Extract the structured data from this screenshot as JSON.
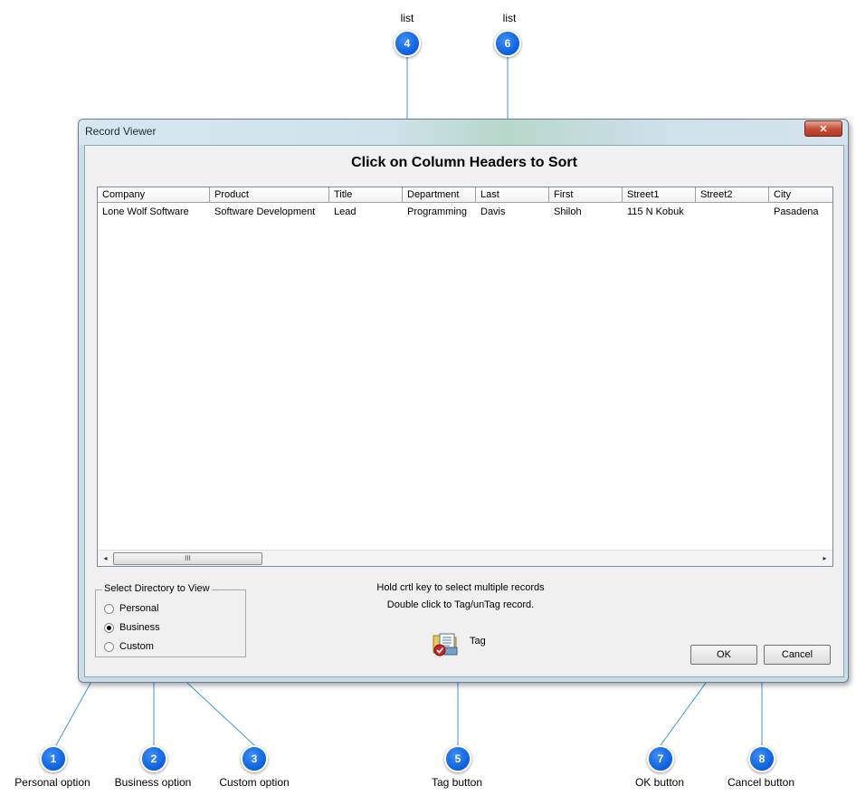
{
  "window": {
    "title": "Record Viewer",
    "close_glyph": "✕",
    "heading": "Click on Column Headers to Sort"
  },
  "list": {
    "columns": [
      "Company",
      "Product",
      "Title",
      "Department",
      "Last",
      "First",
      "Street1",
      "Street2",
      "City"
    ],
    "rows": [
      [
        "Lone Wolf Software",
        "Software Development",
        "Lead",
        "Programming",
        "Davis",
        "Shiloh",
        "115 N Kobuk",
        "",
        "Pasadena"
      ]
    ],
    "scroll_left": "◂",
    "scroll_right": "▸",
    "thumb_grip": "III"
  },
  "directory": {
    "legend": "Select Directory to View",
    "options": [
      {
        "label": "Personal",
        "selected": false
      },
      {
        "label": "Business",
        "selected": true
      },
      {
        "label": "Custom",
        "selected": false
      }
    ]
  },
  "hints": {
    "line1": "Hold crtl key to select multiple records",
    "line2": "Double click to Tag/unTag record."
  },
  "tag": {
    "label": "Tag",
    "icon": "tag-folder-icon"
  },
  "buttons": {
    "ok": "OK",
    "cancel": "Cancel"
  },
  "callouts": {
    "c1": {
      "number": "1",
      "label": "Personal option"
    },
    "c2": {
      "number": "2",
      "label": "Business option"
    },
    "c3": {
      "number": "3",
      "label": "Custom option"
    },
    "c4": {
      "number": "4",
      "label": "list"
    },
    "c5": {
      "number": "5",
      "label": "Tag button"
    },
    "c6": {
      "number": "6",
      "label": "list"
    },
    "c7": {
      "number": "7",
      "label": "OK button"
    },
    "c8": {
      "number": "8",
      "label": "Cancel button"
    }
  },
  "colors": {
    "callout": "#0a5fdc",
    "leader": "#3b9ad9"
  }
}
